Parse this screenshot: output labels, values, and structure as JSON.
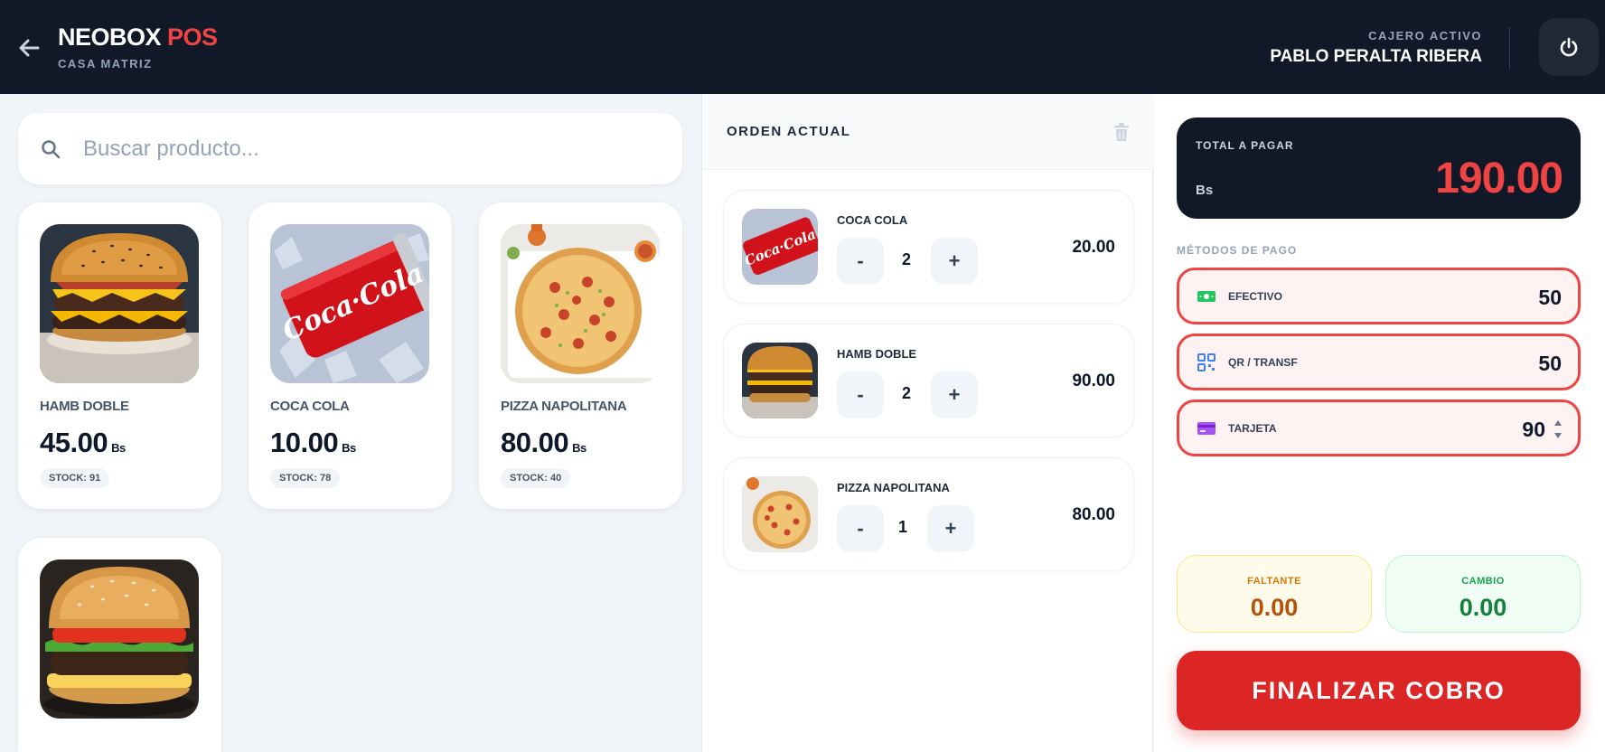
{
  "header": {
    "brand_main": "NEOBOX",
    "brand_accent": "POS",
    "branch": "CASA MATRIZ",
    "cashier_label": "CAJERO ACTIVO",
    "cashier_name": "PABLO PERALTA RIBERA",
    "back_icon": "arrow-left-icon",
    "power_icon": "power-icon"
  },
  "search": {
    "placeholder": "Buscar producto...",
    "value": ""
  },
  "products": [
    {
      "name": "HAMB DOBLE",
      "price": "45.00",
      "currency": "Bs",
      "stock": "STOCK: 91",
      "image": "double-burger"
    },
    {
      "name": "COCA COLA",
      "price": "10.00",
      "currency": "Bs",
      "stock": "STOCK: 78",
      "image": "coca-cola-can"
    },
    {
      "name": "PIZZA NAPOLITANA",
      "price": "80.00",
      "currency": "Bs",
      "stock": "STOCK: 40",
      "image": "pizza"
    },
    {
      "image": "cheeseburger"
    }
  ],
  "order": {
    "title": "ORDEN ACTUAL",
    "clear_icon": "trash-icon",
    "items": [
      {
        "name": "COCA COLA",
        "qty": "2",
        "total": "20.00",
        "minus": "-",
        "plus": "+"
      },
      {
        "name": "HAMB DOBLE",
        "qty": "2",
        "total": "90.00",
        "minus": "-",
        "plus": "+"
      },
      {
        "name": "PIZZA NAPOLITANA",
        "qty": "1",
        "total": "80.00",
        "minus": "-",
        "plus": "+"
      }
    ]
  },
  "payment": {
    "total_label": "TOTAL A PAGAR",
    "currency": "Bs",
    "total": "190.00",
    "methods_label": "MÉTODOS DE PAGO",
    "methods": [
      {
        "label": "EFECTIVO",
        "value": "50",
        "icon": "cash-icon"
      },
      {
        "label": "QR / TRANSF",
        "value": "50",
        "icon": "qr-icon"
      },
      {
        "label": "TARJETA",
        "value": "90",
        "icon": "card-icon"
      }
    ],
    "missing_label": "FALTANTE",
    "missing_value": "0.00",
    "change_label": "CAMBIO",
    "change_value": "0.00",
    "finalize_label": "FINALIZAR COBRO"
  },
  "colors": {
    "header_bg": "#111827",
    "accent_red": "#ef4444",
    "button_red": "#dc2626",
    "missing_bg": "#fffbeb",
    "change_bg": "#f0fdf4"
  }
}
